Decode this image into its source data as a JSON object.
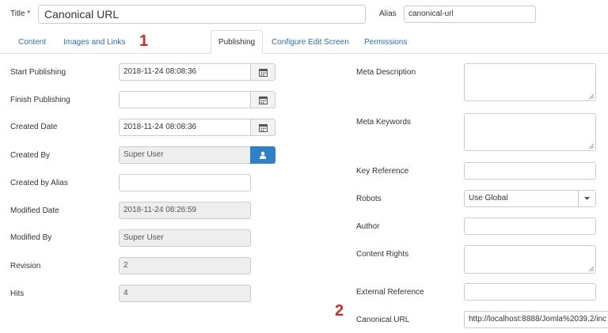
{
  "header": {
    "title_label": "Title *",
    "title_value": "Canonical URL",
    "alias_label": "Alias",
    "alias_value": "canonical-url"
  },
  "tabs": [
    {
      "label": "Content",
      "active": false
    },
    {
      "label": "Images and Links",
      "active": false
    },
    {
      "label": "Publishing",
      "active": true
    },
    {
      "label": "Configure Edit Screen",
      "active": false
    },
    {
      "label": "Permissions",
      "active": false
    }
  ],
  "markers": {
    "one": "1",
    "two": "2"
  },
  "left": {
    "start_publishing": {
      "label": "Start Publishing",
      "value": "2018-11-24 08:08:36"
    },
    "finish_publishing": {
      "label": "Finish Publishing",
      "value": ""
    },
    "created_date": {
      "label": "Created Date",
      "value": "2018-11-24 08:08:36"
    },
    "created_by": {
      "label": "Created By",
      "value": "Super User"
    },
    "created_by_alias": {
      "label": "Created by Alias",
      "value": ""
    },
    "modified_date": {
      "label": "Modified Date",
      "value": "2018-11-24 08:26:59"
    },
    "modified_by": {
      "label": "Modified By",
      "value": "Super User"
    },
    "revision": {
      "label": "Revision",
      "value": "2"
    },
    "hits": {
      "label": "Hits",
      "value": "4"
    }
  },
  "right": {
    "meta_description": {
      "label": "Meta Description",
      "value": ""
    },
    "meta_keywords": {
      "label": "Meta Keywords",
      "value": ""
    },
    "key_reference": {
      "label": "Key Reference",
      "value": ""
    },
    "robots": {
      "label": "Robots",
      "value": "Use Global"
    },
    "author": {
      "label": "Author",
      "value": ""
    },
    "content_rights": {
      "label": "Content Rights",
      "value": ""
    },
    "external_reference": {
      "label": "External Reference",
      "value": ""
    },
    "canonical_url": {
      "label": "Canonical URL",
      "value": "http://localhost:8888/Jomla%2039.2/inc"
    }
  },
  "icons": {
    "calendar": "calendar-icon",
    "user": "user-icon",
    "dropdown": "caret-down-icon",
    "resize": "resize-grip-icon"
  },
  "colors": {
    "link": "#2a6fb5",
    "primary_button": "#2d81c9",
    "marker": "#d9262b",
    "readonly_bg": "#eeeeee"
  }
}
